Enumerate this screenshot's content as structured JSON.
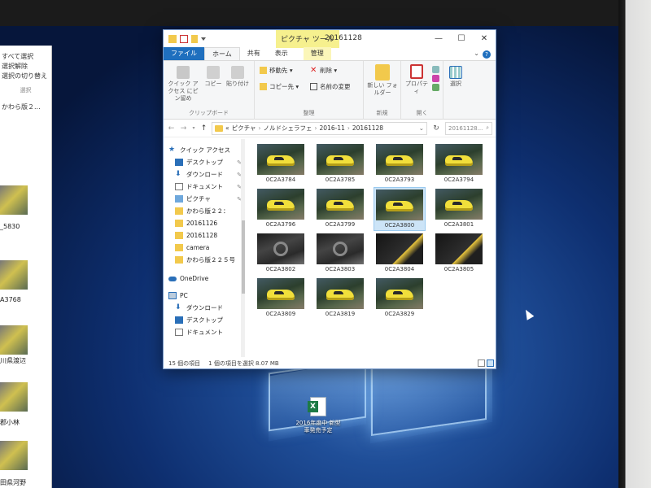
{
  "background_window": {
    "commands": [
      "すべて選択",
      "選択解除",
      "選択の切り替え"
    ],
    "group_label": "選択",
    "folder_item": "かわら版２...",
    "photos": [
      {
        "caption": "_5830"
      },
      {
        "caption": "A3768"
      },
      {
        "caption": "川県渡辺"
      },
      {
        "caption": "郡小林"
      },
      {
        "caption": "田県河野"
      }
    ]
  },
  "window": {
    "context_tab_header": "ピクチャ ツール",
    "title": "20161128",
    "controls": {
      "minimize": "—",
      "maximize": "☐",
      "close": "✕"
    },
    "tabs": [
      {
        "label": "ファイル"
      },
      {
        "label": "ホーム"
      },
      {
        "label": "共有"
      },
      {
        "label": "表示"
      },
      {
        "label": "管理"
      }
    ],
    "help": "?"
  },
  "ribbon": {
    "clipboard": {
      "pin_label": "クイック アクセス にピン留め",
      "copy_label": "コピー",
      "paste_label": "貼り付け",
      "group_label": "クリップボード"
    },
    "organize": {
      "move_label": "移動先 ▾",
      "delete_label": "削除 ▾",
      "copyto_label": "コピー先 ▾",
      "rename_label": "名前の変更",
      "group_label": "整理"
    },
    "new": {
      "newfolder_label": "新しい フォルダー",
      "group_label": "新規"
    },
    "open": {
      "properties_label": "プロパティ",
      "group_label": "開く"
    },
    "select": {
      "select_label": "選択"
    }
  },
  "address": {
    "prefix": "«",
    "crumbs": [
      "ピクチャ",
      "ノルドシェラフェ",
      "2016-11",
      "20161128"
    ],
    "search_placeholder": "20161128..."
  },
  "nav_pane": {
    "items": [
      {
        "label": "クイック アクセス",
        "icon": "star-icon"
      },
      {
        "label": "デスクトップ",
        "icon": "desktop-icon"
      },
      {
        "label": "ダウンロード",
        "icon": "download-icon"
      },
      {
        "label": "ドキュメント",
        "icon": "document-icon"
      },
      {
        "label": "ピクチャ",
        "icon": "pictures-icon"
      },
      {
        "label": "かわら版２２：",
        "icon": "folder-icon"
      },
      {
        "label": "20161126",
        "icon": "folder-icon"
      },
      {
        "label": "20161128",
        "icon": "folder-icon"
      },
      {
        "label": "camera",
        "icon": "folder-icon"
      },
      {
        "label": "かわら版２２５号",
        "icon": "folder-icon"
      },
      {
        "label": "OneDrive",
        "icon": "cloud-icon"
      },
      {
        "label": "PC",
        "icon": "pc-icon"
      },
      {
        "label": "ダウンロード",
        "icon": "download-icon"
      },
      {
        "label": "デスクトップ",
        "icon": "desktop-icon"
      },
      {
        "label": "ドキュメント",
        "icon": "document-icon"
      }
    ]
  },
  "files": [
    {
      "name": "0C2A3784",
      "kind": "car"
    },
    {
      "name": "0C2A3785",
      "kind": "car"
    },
    {
      "name": "0C2A3793",
      "kind": "car"
    },
    {
      "name": "0C2A3794",
      "kind": "car"
    },
    {
      "name": "0C2A3796",
      "kind": "car"
    },
    {
      "name": "0C2A3799",
      "kind": "car"
    },
    {
      "name": "0C2A3800",
      "kind": "car",
      "selected": true
    },
    {
      "name": "0C2A3801",
      "kind": "car"
    },
    {
      "name": "0C2A3802",
      "kind": "interior"
    },
    {
      "name": "0C2A3803",
      "kind": "interior"
    },
    {
      "name": "0C2A3804",
      "kind": "seat"
    },
    {
      "name": "0C2A3805",
      "kind": "seat"
    },
    {
      "name": "0C2A3809",
      "kind": "car"
    },
    {
      "name": "0C2A3819",
      "kind": "car"
    },
    {
      "name": "0C2A3829",
      "kind": "car"
    }
  ],
  "status": {
    "count": "15 個の項目",
    "selection": "1 個の項目を選択  8.07 MB"
  },
  "desktop": {
    "icon_label_1": "2016年度中 新型",
    "icon_label_2": "車発売予定"
  },
  "colors": {
    "file_tab": "#1f6fbe",
    "context_tab": "#f6f08e",
    "selection": "#cce4f7",
    "folder": "#f2c94c"
  }
}
